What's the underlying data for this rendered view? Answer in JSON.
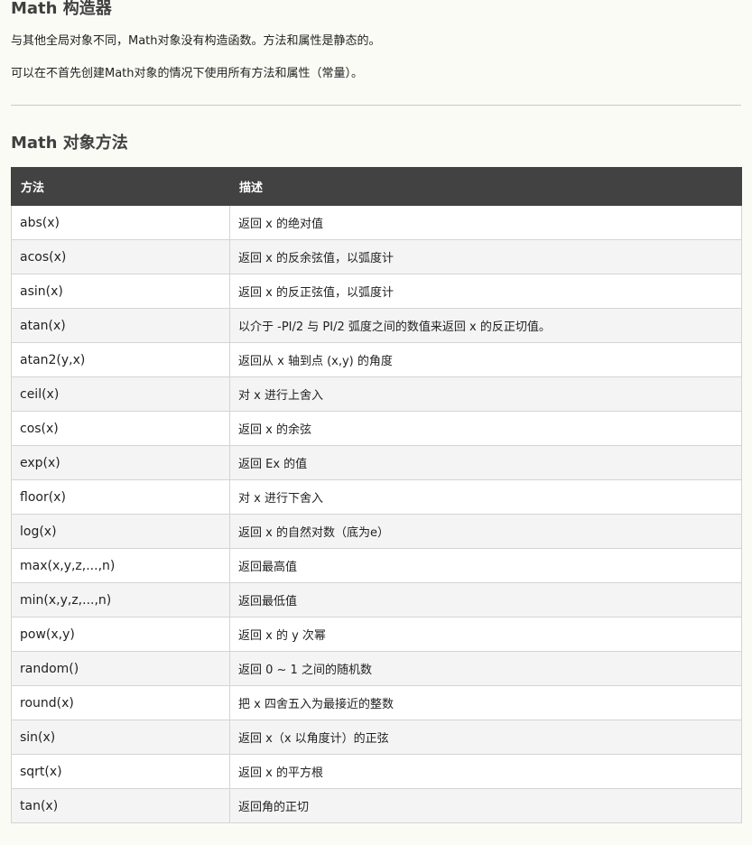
{
  "constructor_section": {
    "title": "Math 构造器",
    "paragraphs": [
      "与其他全局对象不同，Math对象没有构造函数。方法和属性是静态的。",
      "可以在不首先创建Math对象的情况下使用所有方法和属性（常量）。"
    ]
  },
  "methods_section": {
    "title": "Math 对象方法",
    "table": {
      "headers": [
        "方法",
        "描述"
      ],
      "rows": [
        {
          "method": "abs(x)",
          "desc": "返回 x 的绝对值"
        },
        {
          "method": "acos(x)",
          "desc": "返回 x 的反余弦值，以弧度计"
        },
        {
          "method": "asin(x)",
          "desc": "返回 x 的反正弦值，以弧度计"
        },
        {
          "method": "atan(x)",
          "desc": "以介于 -PI/2 与 PI/2 弧度之间的数值来返回 x 的反正切值。"
        },
        {
          "method": "atan2(y,x)",
          "desc": "返回从 x 轴到点 (x,y) 的角度"
        },
        {
          "method": "ceil(x)",
          "desc": "对 x 进行上舍入"
        },
        {
          "method": "cos(x)",
          "desc": "返回 x 的余弦"
        },
        {
          "method": "exp(x)",
          "desc": "返回 Ex 的值"
        },
        {
          "method": "floor(x)",
          "desc": "对 x 进行下舍入"
        },
        {
          "method": "log(x)",
          "desc": "返回 x 的自然对数（底为e）"
        },
        {
          "method": "max(x,y,z,...,n)",
          "desc": "返回最高值"
        },
        {
          "method": "min(x,y,z,...,n)",
          "desc": "返回最低值"
        },
        {
          "method": "pow(x,y)",
          "desc": "返回 x 的 y 次幂"
        },
        {
          "method": "random()",
          "desc": "返回 0 ~ 1 之间的随机数"
        },
        {
          "method": "round(x)",
          "desc": "把 x 四舍五入为最接近的整数"
        },
        {
          "method": "sin(x)",
          "desc": "返回 x（x 以角度计）的正弦"
        },
        {
          "method": "sqrt(x)",
          "desc": "返回 x 的平方根"
        },
        {
          "method": "tan(x)",
          "desc": "返回角的正切"
        }
      ]
    }
  }
}
